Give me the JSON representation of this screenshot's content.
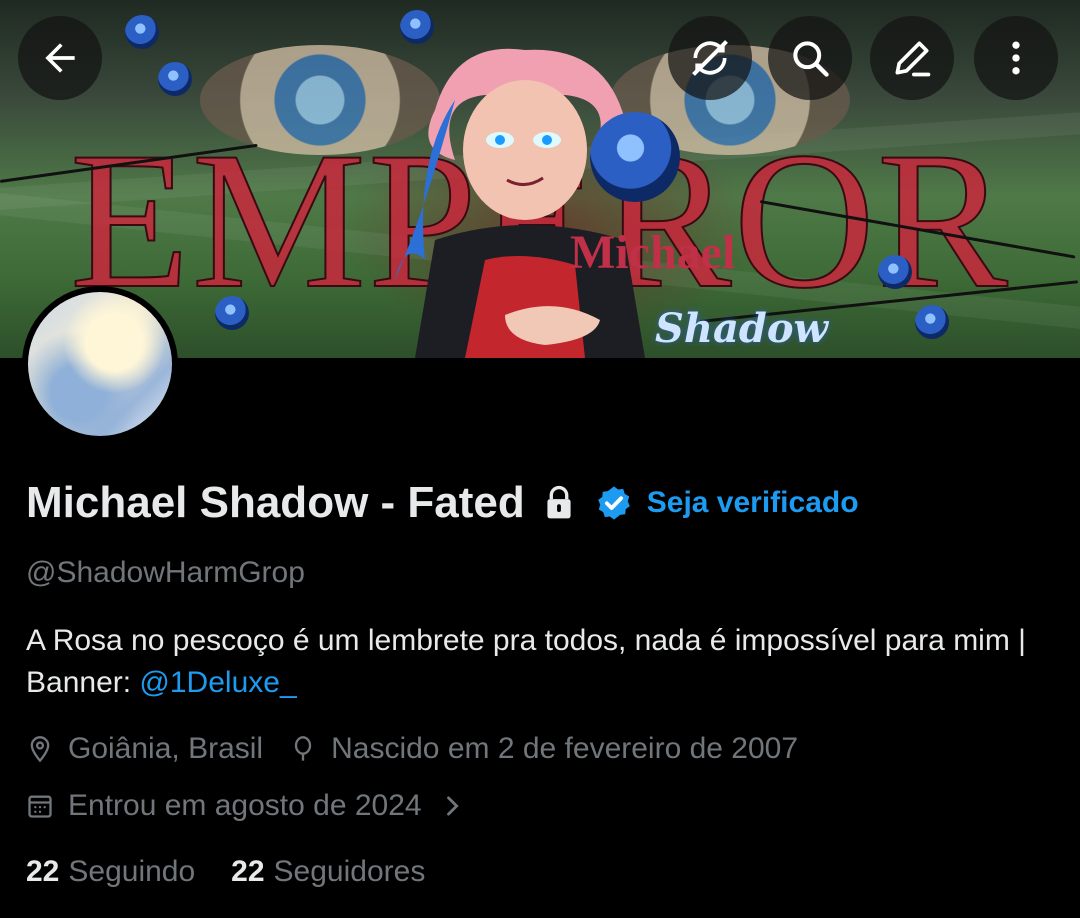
{
  "banner": {
    "title_text": "EMPEROR",
    "subtitle_1": "Michael",
    "subtitle_2": "Shadow"
  },
  "topbar": {
    "back_icon": "arrow-left-icon",
    "sync_icon": "sync-off-icon",
    "search_icon": "search-icon",
    "edit_icon": "pencil-icon",
    "more_icon": "more-vertical-icon"
  },
  "profile": {
    "display_name": "Michael Shadow - Fated",
    "verify_cta": "Seja verificado",
    "handle": "@ShadowHarmGrop",
    "bio_text": "A Rosa no pescoço é um lembrete pra todos, nada é impossível para mim | Banner: ",
    "bio_mention": "@1Deluxe_",
    "location": "Goiânia, Brasil",
    "birthday": "Nascido em 2 de fevereiro de 2007",
    "joined": "Entrou em agosto de 2024",
    "following_count": "22",
    "following_label": "Seguindo",
    "followers_count": "22",
    "followers_label": "Seguidores"
  },
  "colors": {
    "background": "#000000",
    "text_primary": "#e7e9ea",
    "text_secondary": "#71767b",
    "accent": "#1d9bf0"
  }
}
